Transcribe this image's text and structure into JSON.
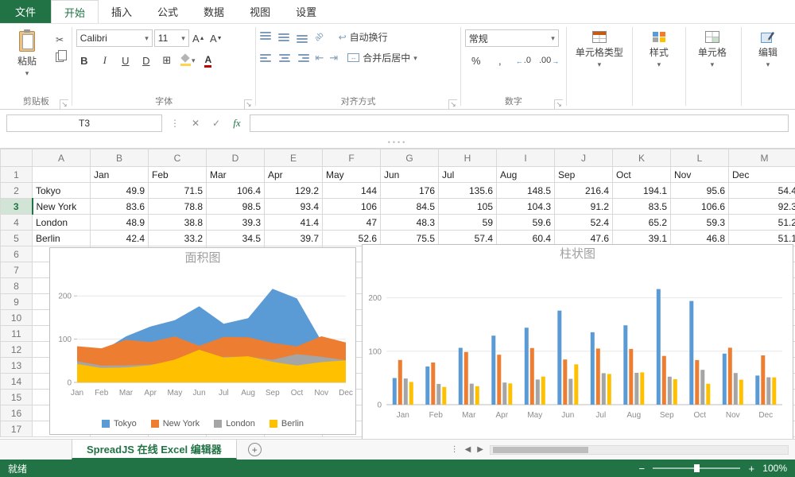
{
  "menubar": {
    "file_tab": "文件",
    "tabs": [
      "开始",
      "插入",
      "公式",
      "数据",
      "视图",
      "设置"
    ],
    "active_tab": "开始"
  },
  "ribbon": {
    "clipboard": {
      "group_label": "剪贴板",
      "paste_label": "粘贴"
    },
    "font": {
      "group_label": "字体",
      "font_name": "Calibri",
      "font_size": "11",
      "bold": "B",
      "italic": "I",
      "underline": "U",
      "double_underline": "D",
      "color_letter": "A"
    },
    "alignment": {
      "group_label": "对齐方式",
      "wrap_label": "自动换行",
      "merge_label": "合并后居中",
      "orient_label": "ab"
    },
    "number": {
      "group_label": "数字",
      "format_value": "常规",
      "percent": "%",
      "comma": ",",
      "inc_decimal_text": ".0",
      "dec_decimal_text": ".00"
    },
    "cell_buttons": [
      {
        "label": "单元格类型"
      },
      {
        "label": "样式"
      },
      {
        "label": "单元格"
      },
      {
        "label": "编辑"
      }
    ]
  },
  "formula_bar": {
    "cell_ref": "T3",
    "fx_label": "fx",
    "value": ""
  },
  "grid": {
    "columns": [
      "A",
      "B",
      "C",
      "D",
      "E",
      "F",
      "G",
      "H",
      "I",
      "J",
      "K",
      "L",
      "M"
    ],
    "row_count": 17,
    "selected_row": 3,
    "rows": [
      [
        "",
        "Jan",
        "Feb",
        "Mar",
        "Apr",
        "May",
        "Jun",
        "Jul",
        "Aug",
        "Sep",
        "Oct",
        "Nov",
        "Dec"
      ],
      [
        "Tokyo",
        "49.9",
        "71.5",
        "106.4",
        "129.2",
        "144",
        "176",
        "135.6",
        "148.5",
        "216.4",
        "194.1",
        "95.6",
        "54.4"
      ],
      [
        "New York",
        "83.6",
        "78.8",
        "98.5",
        "93.4",
        "106",
        "84.5",
        "105",
        "104.3",
        "91.2",
        "83.5",
        "106.6",
        "92.3"
      ],
      [
        "London",
        "48.9",
        "38.8",
        "39.3",
        "41.4",
        "47",
        "48.3",
        "59",
        "59.6",
        "52.4",
        "65.2",
        "59.3",
        "51.2"
      ],
      [
        "Berlin",
        "42.4",
        "33.2",
        "34.5",
        "39.7",
        "52.6",
        "75.5",
        "57.4",
        "60.4",
        "47.6",
        "39.1",
        "46.8",
        "51.1"
      ]
    ]
  },
  "chart_data": [
    {
      "type": "area",
      "title": "面积图",
      "categories": [
        "Jan",
        "Feb",
        "Mar",
        "Apr",
        "May",
        "Jun",
        "Jul",
        "Aug",
        "Sep",
        "Oct",
        "Nov",
        "Dec"
      ],
      "series": [
        {
          "name": "Tokyo",
          "color": "#5b9bd5",
          "values": [
            49.9,
            71.5,
            106.4,
            129.2,
            144,
            176,
            135.6,
            148.5,
            216.4,
            194.1,
            95.6,
            54.4
          ]
        },
        {
          "name": "New York",
          "color": "#ed7d31",
          "values": [
            83.6,
            78.8,
            98.5,
            93.4,
            106,
            84.5,
            105,
            104.3,
            91.2,
            83.5,
            106.6,
            92.3
          ]
        },
        {
          "name": "London",
          "color": "#a5a5a5",
          "values": [
            48.9,
            38.8,
            39.3,
            41.4,
            47,
            48.3,
            59,
            59.6,
            52.4,
            65.2,
            59.3,
            51.2
          ]
        },
        {
          "name": "Berlin",
          "color": "#ffc000",
          "values": [
            42.4,
            33.2,
            34.5,
            39.7,
            52.6,
            75.5,
            57.4,
            60.4,
            47.6,
            39.1,
            46.8,
            51.1
          ]
        }
      ],
      "xlabel": "",
      "ylabel": "",
      "ylim": [
        0,
        250
      ],
      "yticks": [
        0,
        100,
        200
      ],
      "legend": "bottom",
      "overlap": true
    },
    {
      "type": "bar",
      "title": "柱状图",
      "categories": [
        "Jan",
        "Feb",
        "Mar",
        "Apr",
        "May",
        "Jun",
        "Jul",
        "Aug",
        "Sep",
        "Oct",
        "Nov",
        "Dec"
      ],
      "series": [
        {
          "name": "Tokyo",
          "color": "#5b9bd5",
          "values": [
            49.9,
            71.5,
            106.4,
            129.2,
            144,
            176,
            135.6,
            148.5,
            216.4,
            194.1,
            95.6,
            54.4
          ]
        },
        {
          "name": "New York",
          "color": "#ed7d31",
          "values": [
            83.6,
            78.8,
            98.5,
            93.4,
            106,
            84.5,
            105,
            104.3,
            91.2,
            83.5,
            106.6,
            92.3
          ]
        },
        {
          "name": "London",
          "color": "#a5a5a5",
          "values": [
            48.9,
            38.8,
            39.3,
            41.4,
            47,
            48.3,
            59,
            59.6,
            52.4,
            65.2,
            59.3,
            51.2
          ]
        },
        {
          "name": "Berlin",
          "color": "#ffc000",
          "values": [
            42.4,
            33.2,
            34.5,
            39.7,
            52.6,
            75.5,
            57.4,
            60.4,
            47.6,
            39.1,
            46.8,
            51.1
          ]
        }
      ],
      "xlabel": "",
      "ylabel": "",
      "ylim": [
        0,
        250
      ],
      "yticks": [
        0,
        100,
        200
      ],
      "legend": "none",
      "overlap": false
    }
  ],
  "sheet_bar": {
    "active_sheet": "SpreadJS 在线 Excel 编辑器"
  },
  "status_bar": {
    "status": "就绪",
    "zoom_label": "100%"
  }
}
